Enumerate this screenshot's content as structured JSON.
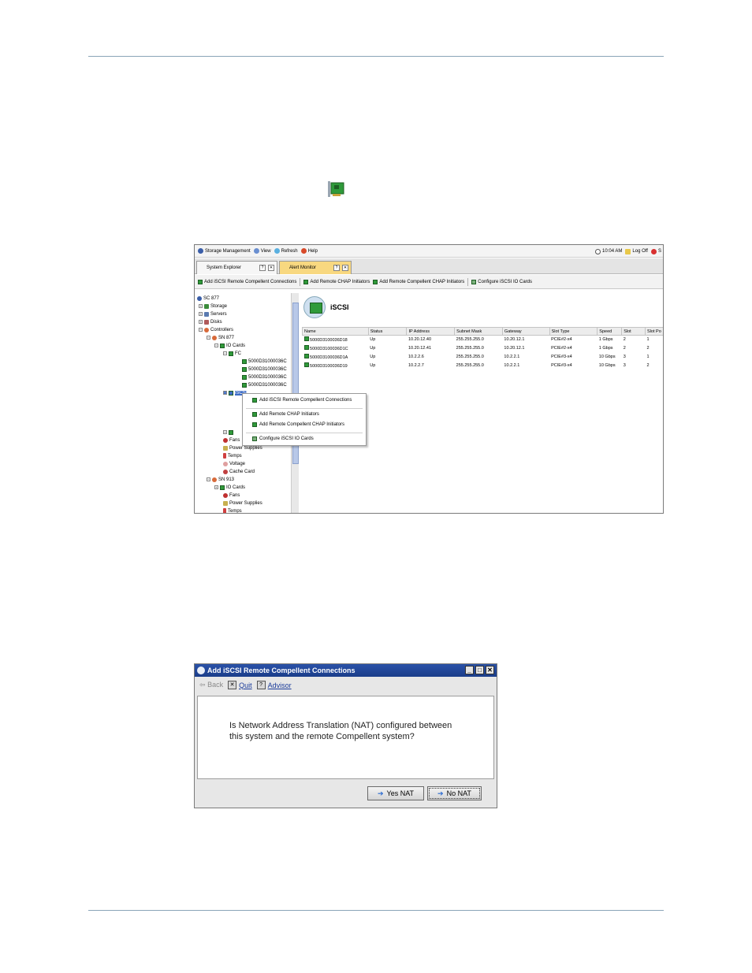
{
  "menubar": {
    "storage_management": "Storage Management",
    "view": "View",
    "refresh": "Refresh",
    "help": "Help",
    "time": "10:04 AM",
    "log_off": "Log Off",
    "cut_letter": "S"
  },
  "tabs": {
    "system_explorer": "System Explorer",
    "alert_monitor": "Alert Monitor",
    "help_glyph": "?",
    "close_glyph": "✕"
  },
  "toolbar": {
    "add_iscsi": "Add iSCSI Remote Compellent Connections",
    "add_chap": "Add Remote CHAP Initiators",
    "add_compellent_chap": "Add Remote Compellent CHAP Initiators",
    "configure": "Configure iSCSI IO Cards"
  },
  "tree": {
    "root": "SC 877",
    "storage": "Storage",
    "servers": "Servers",
    "disks": "Disks",
    "controllers": "Controllers",
    "sn877": "SN 877",
    "io_cards": "IO Cards",
    "fc": "FC",
    "fc_ports": [
      "5000D31000036C",
      "5000D31000036C",
      "5000D31000036C",
      "5000D31000036C"
    ],
    "iscsi": "iSCSI",
    "fans": "Fans",
    "power_supplies": "Power Supplies",
    "temps": "Temps",
    "voltage": "Voltage",
    "cache_card": "Cache Card",
    "sn913": "SN 913",
    "io_cards2": "IO Cards",
    "fans2": "Fans",
    "power_supplies2": "Power Supplies",
    "temps2": "Temps"
  },
  "context_menu": {
    "add_iscsi": "Add iSCSI Remote Compellent Connections",
    "add_chap": "Add Remote CHAP Initiators",
    "add_compellent_chap": "Add Remote Compellent CHAP Initiators",
    "configure": "Configure iSCSI IO Cards"
  },
  "content": {
    "title": "iSCSI",
    "columns": [
      "Name",
      "Status",
      "IP Address",
      "Subnet Mask",
      "Gateway",
      "Slot Type",
      "Speed",
      "Slot",
      "Slot Po"
    ],
    "rows": [
      [
        "5000D3100036D18",
        "Up",
        "10.20.12.40",
        "255.255.255.0",
        "10.20.12.1",
        "PCIE#2-x4",
        "1 Gbps",
        "2",
        "1"
      ],
      [
        "5000D3100036D1C",
        "Up",
        "10.20.12.41",
        "255.255.255.0",
        "10.20.12.1",
        "PCIE#2-x4",
        "1 Gbps",
        "2",
        "2"
      ],
      [
        "5000D3100036D1A",
        "Up",
        "10.2.2.6",
        "255.255.255.0",
        "10.2.2.1",
        "PCIE#3-x4",
        "10 Gbps",
        "3",
        "1"
      ],
      [
        "5000D3100036D19",
        "Up",
        "10.2.2.7",
        "255.255.255.0",
        "10.2.2.1",
        "PCIE#3-x4",
        "10 Gbps",
        "3",
        "2"
      ]
    ]
  },
  "dialog": {
    "title": "Add iSCSI Remote Compellent Connections",
    "back": "Back",
    "quit": "Quit",
    "advisor": "Advisor",
    "quit_glyph": "✕",
    "advisor_glyph": "?",
    "question": "Is Network Address Translation (NAT) configured between this system and the remote Compellent system?",
    "yes_nat": "Yes NAT",
    "no_nat": "No NAT",
    "minimize_glyph": "_",
    "maximize_glyph": "□",
    "close_glyph": "✕",
    "arrow_glyph": "➔",
    "back_glyph": "⇦"
  }
}
